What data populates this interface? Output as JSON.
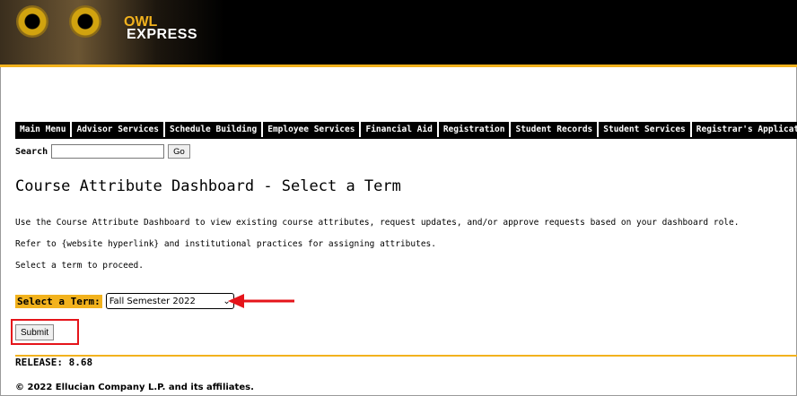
{
  "brand": {
    "line1": "OWL",
    "line2": "EXPRESS"
  },
  "tabs": [
    {
      "label": "Main Menu"
    },
    {
      "label": "Advisor Services"
    },
    {
      "label": "Schedule Building"
    },
    {
      "label": "Employee Services"
    },
    {
      "label": "Financial Aid"
    },
    {
      "label": "Registration"
    },
    {
      "label": "Student Records"
    },
    {
      "label": "Student Services"
    },
    {
      "label": "Registrar's Application"
    }
  ],
  "search": {
    "label": "Search",
    "value": "",
    "button": "Go"
  },
  "page": {
    "title": "Course Attribute Dashboard - Select a Term",
    "paragraphs": [
      "Use the Course Attribute Dashboard to view existing course attributes, request updates, and/or approve requests based on your dashboard role.",
      "Refer to {website hyperlink} and institutional practices for assigning attributes.",
      "Select a term to proceed."
    ]
  },
  "term": {
    "label": "Select a Term:",
    "selected": "Fall Semester 2022"
  },
  "form": {
    "submit": "Submit"
  },
  "footer": {
    "release": "RELEASE: 8.68",
    "copyright": "© 2022 Ellucian Company L.P. and its affiliates."
  },
  "colors": {
    "gold": "#f2b21d",
    "highlight_red": "#e5141a"
  }
}
